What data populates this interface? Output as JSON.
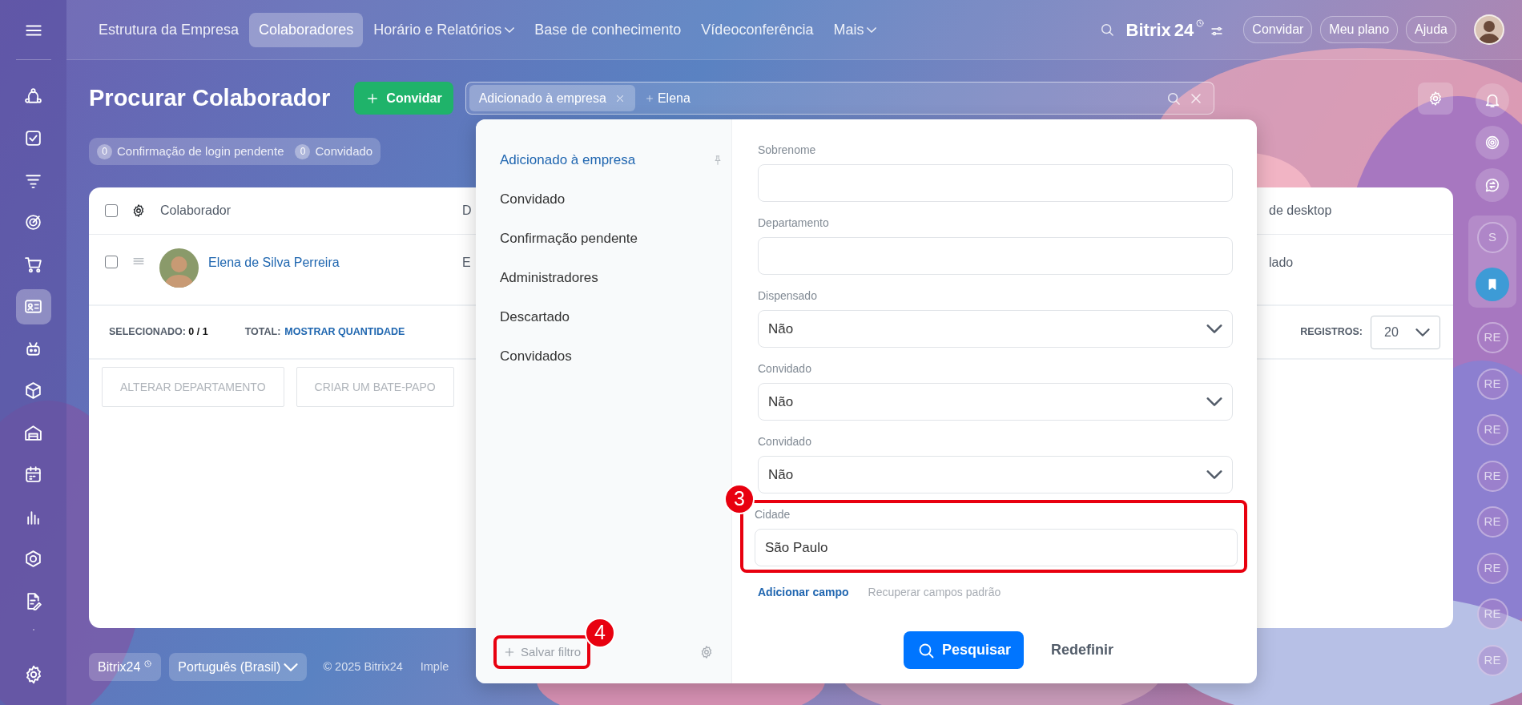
{
  "sidebar": {
    "items": [
      {
        "selected": false
      },
      {
        "selected": false
      },
      {
        "selected": false
      },
      {
        "selected": false
      },
      {
        "selected": false
      },
      {
        "selected": true
      },
      {
        "selected": false
      },
      {
        "selected": false
      },
      {
        "selected": false
      },
      {
        "selected": false
      },
      {
        "selected": false
      },
      {
        "selected": false
      },
      {
        "selected": false
      }
    ]
  },
  "top_nav": {
    "items": [
      {
        "label": "Estrutura da Empresa",
        "selected": false,
        "dropdown": false
      },
      {
        "label": "Colaboradores",
        "selected": true,
        "dropdown": false
      },
      {
        "label": "Horário e Relatórios",
        "selected": false,
        "dropdown": true
      },
      {
        "label": "Base de conhecimento",
        "selected": false,
        "dropdown": false
      },
      {
        "label": "Vídeoconferência",
        "selected": false,
        "dropdown": false
      },
      {
        "label": "Mais",
        "selected": false,
        "dropdown": true
      }
    ],
    "logo": {
      "name": "Bitrix",
      "number": "24"
    },
    "buttons": [
      "Convidar",
      "Meu plano",
      "Ajuda"
    ]
  },
  "page": {
    "title": "Procurar Colaborador",
    "invite_button": "Convidar",
    "search": {
      "chips": [
        {
          "label": "Adicionado à empresa"
        }
      ],
      "value": "Elena"
    },
    "counters": [
      {
        "count": "0",
        "label": "Confirmação de login pendente"
      },
      {
        "count": "0",
        "label": "Convidado"
      }
    ]
  },
  "table": {
    "header_checked": false,
    "columns": [
      {
        "label": "Colaborador"
      },
      {
        "label": "D"
      },
      {
        "label": "de desktop"
      }
    ],
    "rows": [
      {
        "checked": false,
        "cells": [
          "Elena de Silva Perreira",
          "E",
          "lado"
        ]
      }
    ],
    "summary": {
      "selected": "SELECIONADO: **0 / 1**",
      "total_label": "TOTAL:",
      "total_link": "MOSTRAR QUANTIDADE",
      "page_size_label": "REGISTROS:",
      "page_size": "20"
    },
    "actions": [
      {
        "label": "ALTERAR DEPARTAMENTO",
        "disabled": true
      },
      {
        "label": "CRIAR UM BATE-PAPO",
        "disabled": true
      }
    ]
  },
  "footer": {
    "brand": "Bitrix24",
    "language": "Português (Brasil)",
    "copyright": "© 2025 Bitrix24",
    "link": "Imple"
  },
  "filter_popup": {
    "presets": [
      {
        "label": "Adicionado à empresa",
        "selected": true,
        "pinned": true
      },
      {
        "label": "Convidado",
        "selected": false,
        "pinned": false
      },
      {
        "label": "Confirmação pendente",
        "selected": false,
        "pinned": false
      },
      {
        "label": "Administradores",
        "selected": false,
        "pinned": false
      },
      {
        "label": "Descartado",
        "selected": false,
        "pinned": false
      },
      {
        "label": "Convidados",
        "selected": false,
        "pinned": false
      }
    ],
    "save_filter": {
      "label": "Salvar filtro",
      "marker": "4"
    },
    "fields": [
      {
        "label": "Sobrenome",
        "kind": "text"
      },
      {
        "label": "Departamento",
        "kind": "text"
      },
      {
        "label": "Dispensado",
        "kind": "select",
        "value": "Não"
      },
      {
        "label": "Convidado",
        "kind": "select",
        "value": "Não"
      },
      {
        "label": "Convidado",
        "kind": "select",
        "value": "Não"
      },
      {
        "label": "Cidade",
        "kind": "text",
        "value": "São Paulo",
        "marker": "3"
      }
    ],
    "add_field": "Adicionar campo",
    "restore_fields": "Recuperar campos padrão",
    "search_button": "Pesquisar",
    "reset_button": "Redefinir"
  },
  "right_rail": {
    "items": [
      {
        "kind": "avatar",
        "text": "S"
      },
      {
        "kind": "bookmark"
      },
      {
        "kind": "avatar",
        "text": "RE"
      },
      {
        "kind": "avatar",
        "text": "RE"
      },
      {
        "kind": "avatar",
        "text": "RE"
      },
      {
        "kind": "avatar",
        "text": "RE"
      },
      {
        "kind": "avatar",
        "text": "RE"
      },
      {
        "kind": "avatar",
        "text": "RE"
      },
      {
        "kind": "avatar",
        "text": "RE"
      },
      {
        "kind": "avatar",
        "text": "RE"
      }
    ]
  }
}
